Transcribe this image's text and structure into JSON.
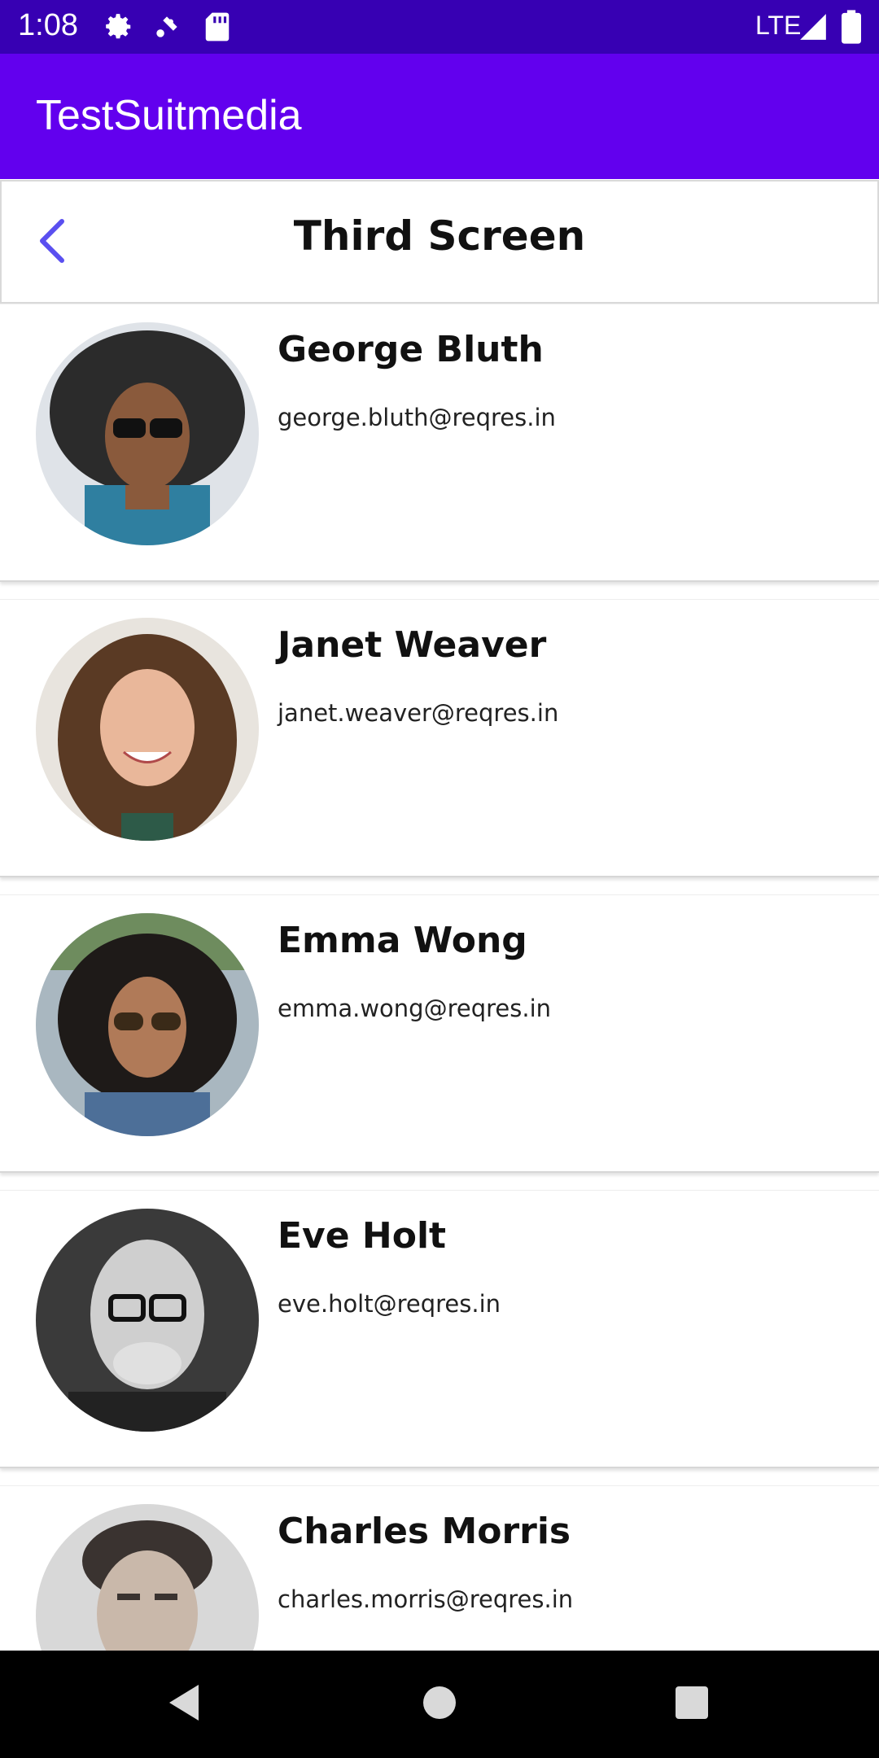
{
  "status_bar": {
    "time": "1:08",
    "network": "LTE",
    "icons": [
      "settings-icon",
      "data-sync-icon",
      "sd-card-icon",
      "signal-icon",
      "battery-icon"
    ]
  },
  "app_bar": {
    "title": "TestSuitmedia",
    "color": "#6200ee"
  },
  "header": {
    "title": "Third Screen",
    "back_icon": "chevron-left-icon",
    "accent": "#5a4ff0"
  },
  "users": [
    {
      "name": "George Bluth",
      "email": "george.bluth@reqres.in"
    },
    {
      "name": "Janet Weaver",
      "email": "janet.weaver@reqres.in"
    },
    {
      "name": "Emma Wong",
      "email": "emma.wong@reqres.in"
    },
    {
      "name": "Eve Holt",
      "email": "eve.holt@reqres.in"
    },
    {
      "name": "Charles Morris",
      "email": "charles.morris@reqres.in"
    }
  ],
  "nav_bar": {
    "icons": [
      "back-triangle-icon",
      "home-circle-icon",
      "recents-square-icon"
    ]
  }
}
